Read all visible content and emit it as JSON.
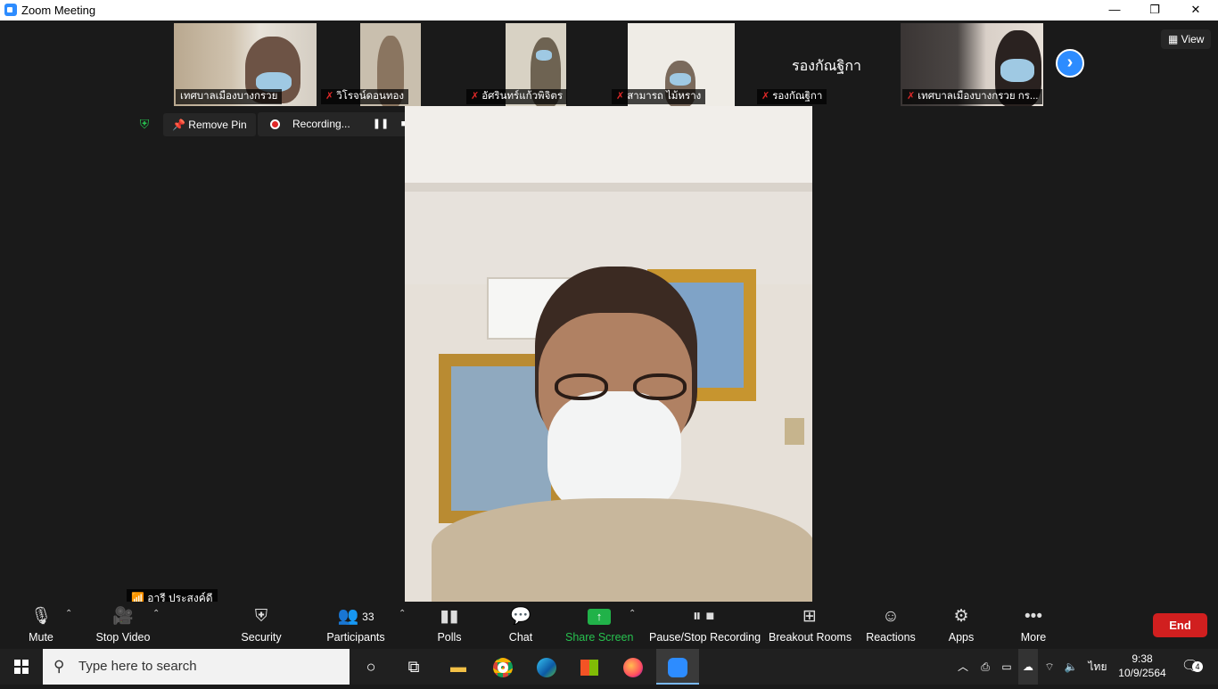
{
  "window": {
    "title": "Zoom Meeting",
    "minimize": "—",
    "restore": "❐",
    "close": "✕"
  },
  "thumbnails": [
    {
      "name": "เทศบาลเมืองบางกรวย",
      "muted": false
    },
    {
      "name": "วิโรจน์ดอนทอง",
      "muted": true
    },
    {
      "name": "อัศรินทร์แก้วพิจิตร",
      "muted": true
    },
    {
      "name": "สามารถ ไม้หราง",
      "muted": true
    },
    {
      "name": "รองกัณฐิกา",
      "muted": true,
      "avatar_text": "รองกัณฐิกา"
    },
    {
      "name": "เทศบาลเมืองบางกรวย กร...",
      "muted": true
    }
  ],
  "view_label": "View",
  "remove_pin_label": "Remove Pin",
  "recording_label": "Recording...",
  "speaker_name": "อารี ประสงค์ดี",
  "toolbar": {
    "mute": "Mute",
    "stop_video": "Stop Video",
    "security": "Security",
    "participants": "Participants",
    "participants_count": "33",
    "polls": "Polls",
    "chat": "Chat",
    "share_screen": "Share Screen",
    "recording": "Pause/Stop Recording",
    "breakout": "Breakout Rooms",
    "reactions": "Reactions",
    "apps": "Apps",
    "more": "More",
    "end": "End"
  },
  "taskbar": {
    "search_placeholder": "Type here to search",
    "language": "ไทย",
    "time": "9:38",
    "date": "10/9/2564",
    "notifications": "4"
  },
  "colors": {
    "accent": "#2d8cff",
    "end": "#d11f1f",
    "share": "#21b249",
    "mute": "#e02828"
  }
}
